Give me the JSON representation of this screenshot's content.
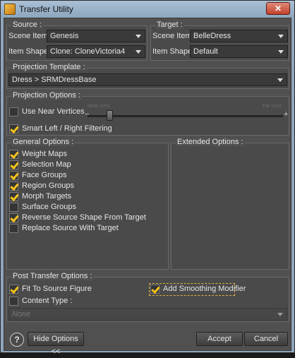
{
  "window": {
    "title": "Transfer Utility",
    "close_icon": "close-icon"
  },
  "source": {
    "legend": "Source :",
    "scene_item_label": "Scene Item :",
    "scene_item_value": "Genesis",
    "item_shape_label": "Item Shape :",
    "item_shape_value": "Clone: CloneVictoria4"
  },
  "target": {
    "legend": "Target :",
    "scene_item_label": "Scene Item :",
    "scene_item_value": "BelleDress",
    "item_shape_label": "Item Shape :",
    "item_shape_value": "Default"
  },
  "projection_template": {
    "legend": "Projection Template :",
    "value": "Dress > SRMDressBase"
  },
  "projection_options": {
    "legend": "Projection Options :",
    "use_near_vertices": {
      "label": "Use Near Vertices",
      "checked": false
    },
    "slider_min_label": "Near (cm)",
    "slider_max_label": "Far (cm)",
    "slider_level": 0.1,
    "smart_filtering": {
      "label": "Smart Left / Right Filtering",
      "checked": true
    }
  },
  "general_options": {
    "legend": "General Options :",
    "items": [
      {
        "label": "Weight Maps",
        "checked": true
      },
      {
        "label": "Selection Map",
        "checked": true
      },
      {
        "label": "Face Groups",
        "checked": true
      },
      {
        "label": "Region Groups",
        "checked": true
      },
      {
        "label": "Morph Targets",
        "checked": true
      },
      {
        "label": "Surface Groups",
        "checked": false
      },
      {
        "label": "Reverse Source Shape From Target",
        "checked": true
      },
      {
        "label": "Replace Source With Target",
        "checked": false
      }
    ]
  },
  "extended_options": {
    "legend": "Extended Options :"
  },
  "post_transfer": {
    "legend": "Post Transfer Options :",
    "fit_to_source": {
      "label": "Fit To Source Figure",
      "checked": true
    },
    "add_smoothing": {
      "label": "Add Smoothing Modifier",
      "checked": true
    },
    "content_type": {
      "label": "Content Type :",
      "checked": false,
      "value": "None"
    }
  },
  "footer": {
    "help_label": "?",
    "hide_options_label": "Hide Options <<",
    "accept_label": "Accept",
    "cancel_label": "Cancel"
  },
  "colors": {
    "accent": "#f3c21a",
    "panel": "#505050",
    "titlebar": "#8ea6bd"
  }
}
